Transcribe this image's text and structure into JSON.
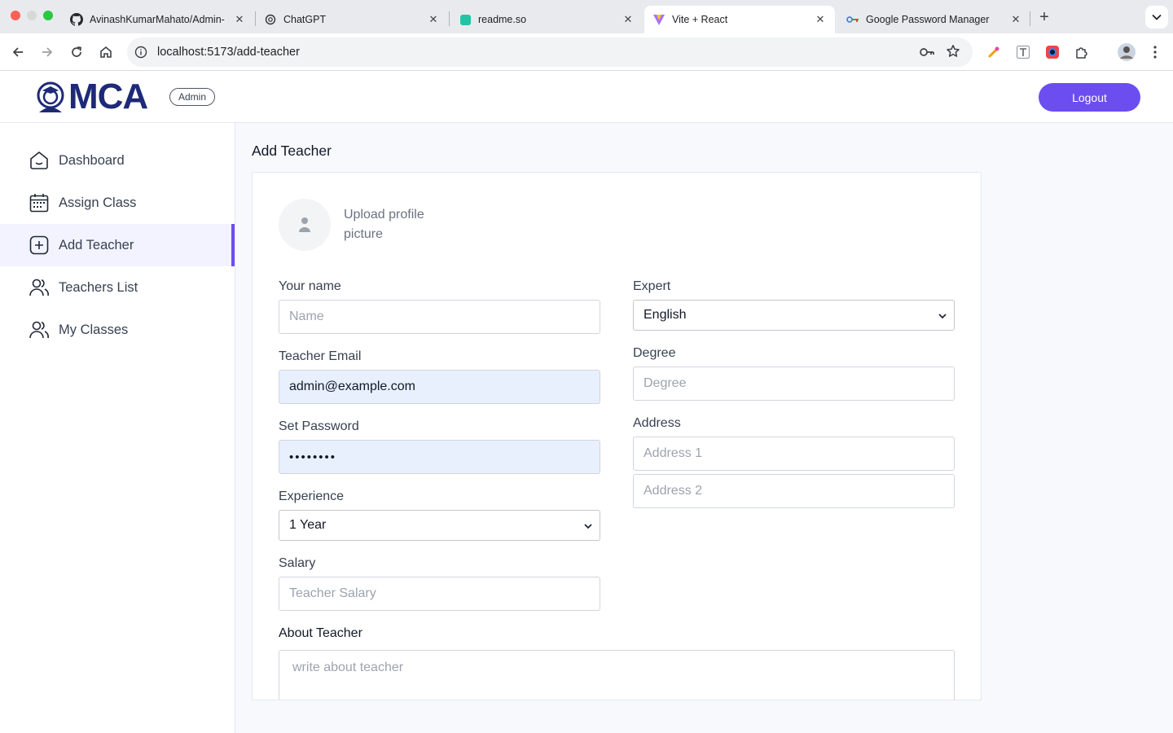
{
  "browser": {
    "tabs": [
      {
        "title": "AvinashKumarMahato/Admin-",
        "favicon": "github-icon"
      },
      {
        "title": "ChatGPT",
        "favicon": "chatgpt-icon"
      },
      {
        "title": "readme.so",
        "favicon": "readme-icon"
      },
      {
        "title": "Vite + React",
        "favicon": "vite-icon",
        "active": true
      },
      {
        "title": "Google Password Manager",
        "favicon": "password-manager-icon"
      }
    ],
    "url": "localhost:5173/add-teacher"
  },
  "header": {
    "logo_text": "MCA",
    "badge": "Admin",
    "logout_label": "Logout"
  },
  "sidebar": {
    "items": [
      {
        "label": "Dashboard",
        "icon": "home-icon"
      },
      {
        "label": "Assign Class",
        "icon": "calendar-icon"
      },
      {
        "label": "Add Teacher",
        "icon": "add-icon",
        "active": true
      },
      {
        "label": "Teachers List",
        "icon": "users-icon"
      },
      {
        "label": "My Classes",
        "icon": "users-icon"
      }
    ]
  },
  "main": {
    "title": "Add Teacher",
    "upload_label": "Upload profile picture",
    "form": {
      "name": {
        "label": "Your name",
        "placeholder": "Name"
      },
      "email": {
        "label": "Teacher Email",
        "value": "admin@example.com"
      },
      "password": {
        "label": "Set Password",
        "value": "••••••••"
      },
      "experience": {
        "label": "Experience",
        "value": "1 Year"
      },
      "salary": {
        "label": "Salary",
        "placeholder": "Teacher Salary"
      },
      "expert": {
        "label": "Expert",
        "value": "English"
      },
      "degree": {
        "label": "Degree",
        "placeholder": "Degree"
      },
      "address": {
        "label": "Address",
        "placeholder1": "Address 1",
        "placeholder2": "Address 2"
      },
      "about": {
        "label": "About Teacher",
        "placeholder": "write about teacher"
      }
    }
  },
  "colors": {
    "accent": "#6c4ef0",
    "logo": "#1e2a78",
    "autofill": "#e8f0fe"
  }
}
